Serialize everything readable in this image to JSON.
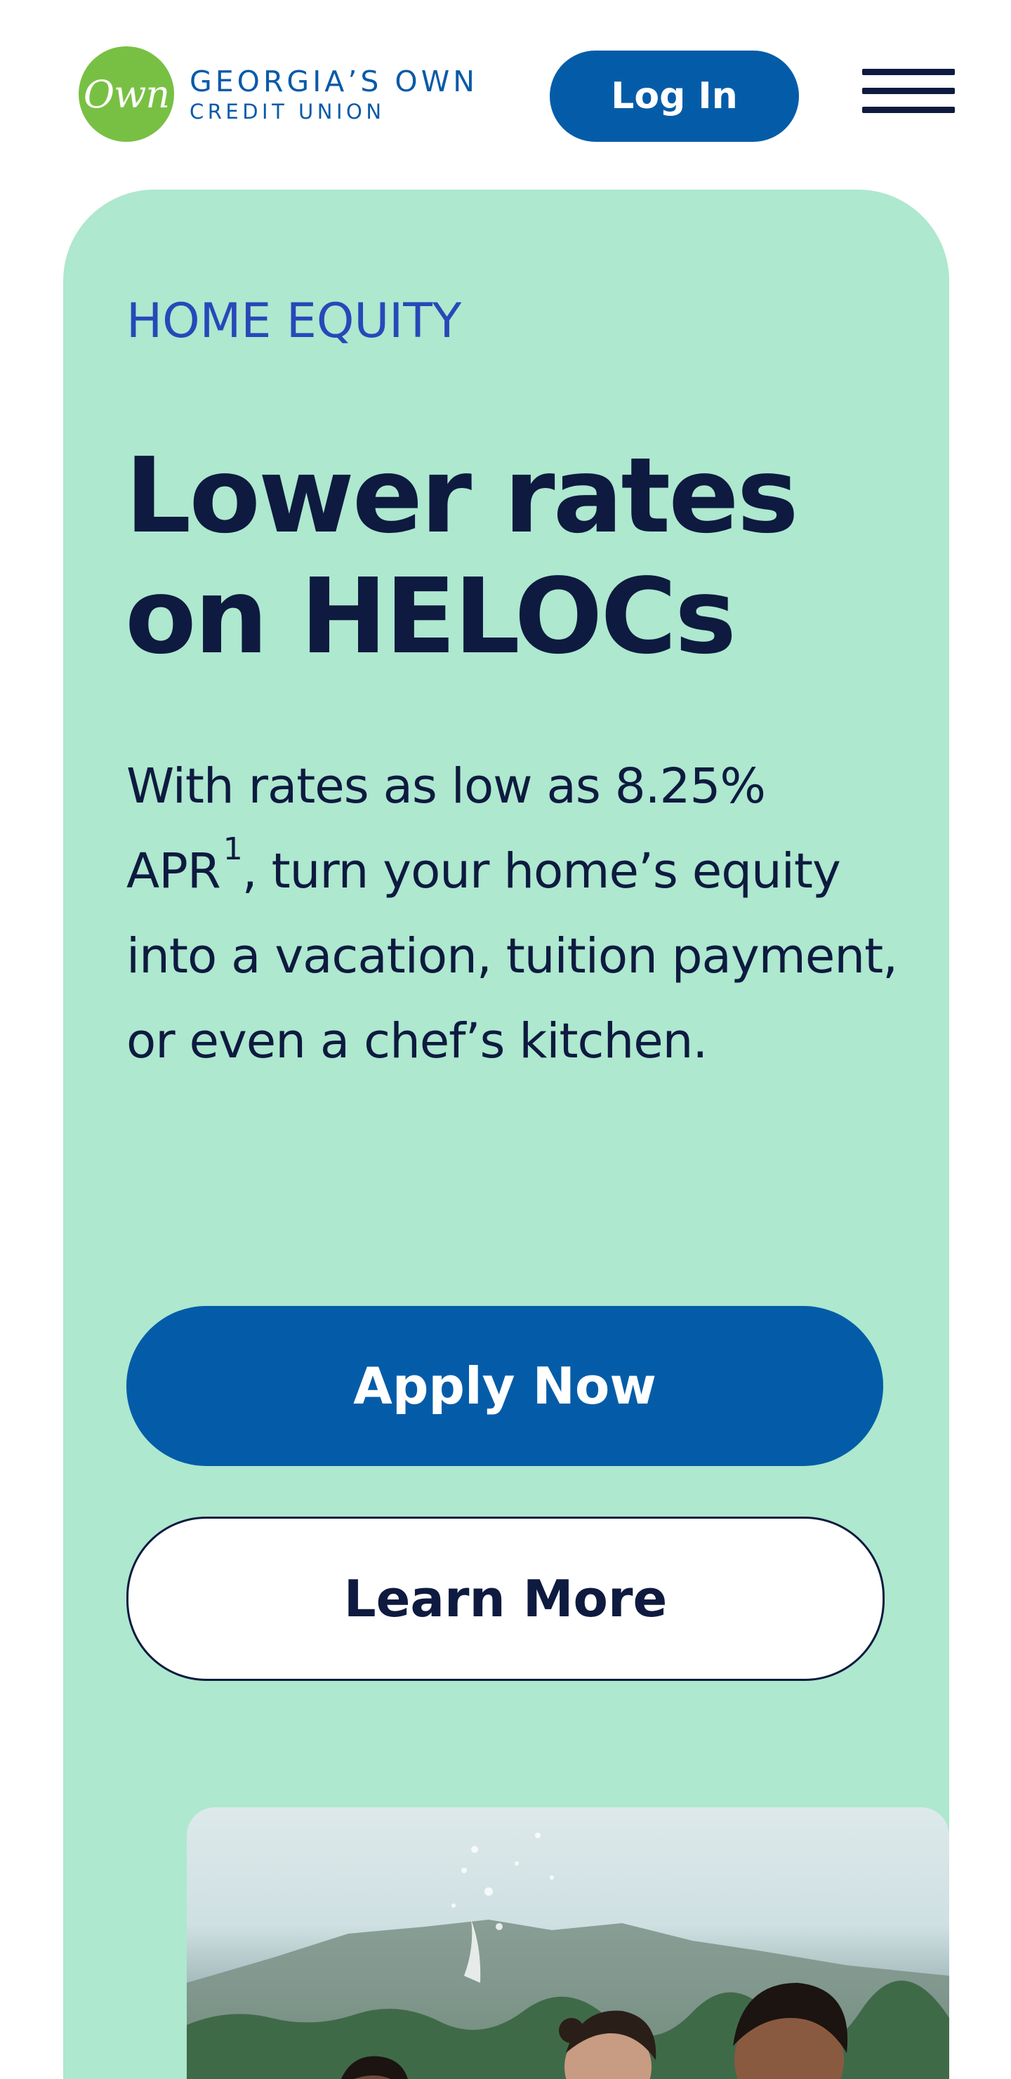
{
  "header": {
    "logo_mark": "Own",
    "logo_name": "GEORGIA’S OWN",
    "logo_sub": "CREDIT UNION",
    "login_label": "Log In",
    "menu_icon": "hamburger-menu-icon"
  },
  "hero": {
    "eyebrow": "HOME EQUITY",
    "headline_line1": "Lower rates",
    "headline_line2": "on HELOCs",
    "body_before_sup": "With rates as low as 8.25% APR",
    "body_sup": "1",
    "body_after_sup": ", turn your home’s equity into a vacation, tuition payment, or even a chef’s kitchen.",
    "apply_label": "Apply Now",
    "learn_label": "Learn More"
  },
  "colors": {
    "brand_blue": "#045ca8",
    "brand_green": "#78c043",
    "hero_background": "#ade8cf",
    "eyebrow_blue": "#2748b8",
    "text_dark": "#0e1a3f"
  }
}
